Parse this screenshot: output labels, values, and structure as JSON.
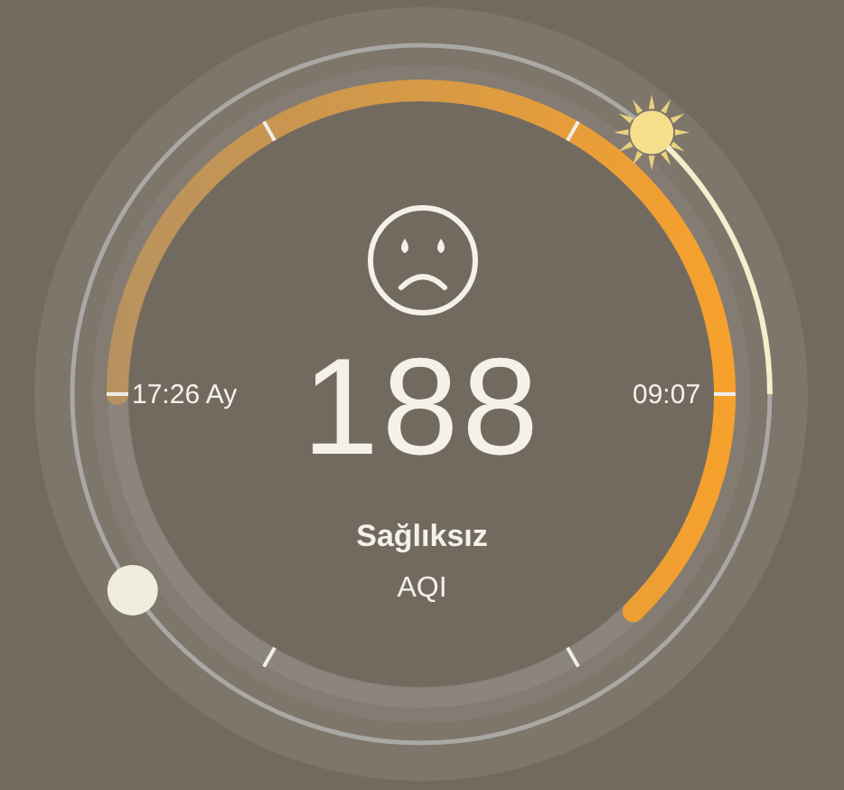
{
  "aqi": {
    "value": "188",
    "status": "Sağlıksız",
    "unit": "AQI"
  },
  "times": {
    "left": "17:26 Ay",
    "right": "09:07"
  }
}
